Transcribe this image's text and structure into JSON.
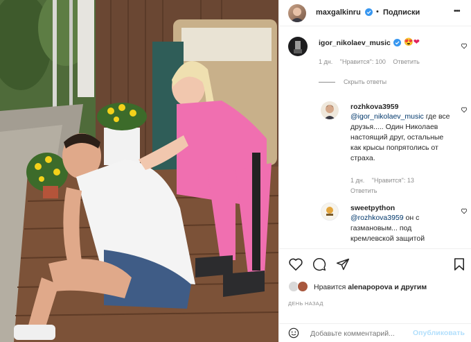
{
  "header": {
    "username": "maxgalkinru",
    "follow_label": "Подписки",
    "more_label": "•••"
  },
  "comments": {
    "top": {
      "username": "igor_nikolaev_music",
      "text": "😍❤",
      "time": "1 дн.",
      "likes": "\"Нравится\": 100",
      "reply": "Ответить"
    },
    "hide_replies": "Скрыть ответы",
    "reply1": {
      "username": "rozhkova3959",
      "mention": "@igor_nikolaev_music",
      "text_line1": " где",
      "text_rest": "все друзья..... Один Николаев настоящий друг, остальные как крысы попрятолись от страха.",
      "time": "1 дн.",
      "likes": "\"Нравится\": 13",
      "reply": "Ответить"
    },
    "reply2": {
      "username": "sweetpython",
      "mention": "@rozhkova3959",
      "text": " он с газмановым... под кремлевской защитой"
    }
  },
  "likes_line": {
    "prefix": "Нравится ",
    "user": "alenapopova",
    "suffix": " и другим"
  },
  "date_label": "ДЕНЬ НАЗАД",
  "add_comment": {
    "placeholder": "Добавьте комментарий...",
    "publish": "Опубликовать"
  },
  "colors": {
    "verified": "#3897f0",
    "link": "#00376b",
    "secondary": "#8e8e8e",
    "publish": "#b2dffc"
  }
}
